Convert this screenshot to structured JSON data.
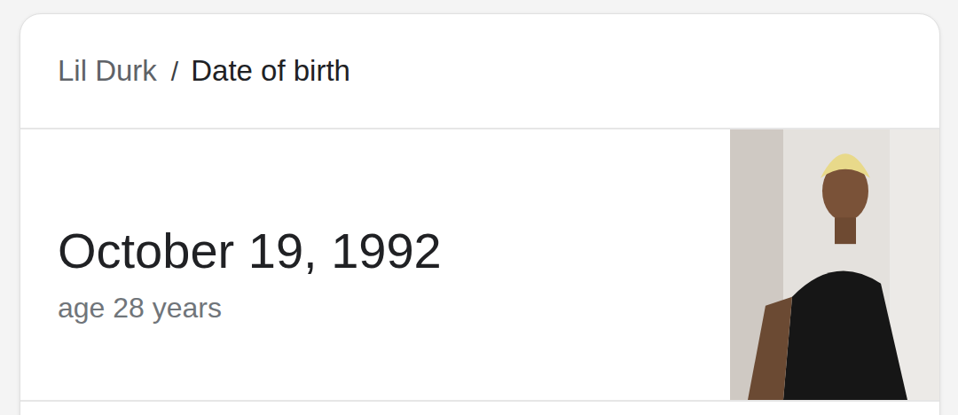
{
  "breadcrumb": {
    "entity": "Lil Durk",
    "separator": "/",
    "attribute": "Date of birth"
  },
  "answer": {
    "value": "October 19, 1992",
    "subtitle": "age 28 years"
  }
}
